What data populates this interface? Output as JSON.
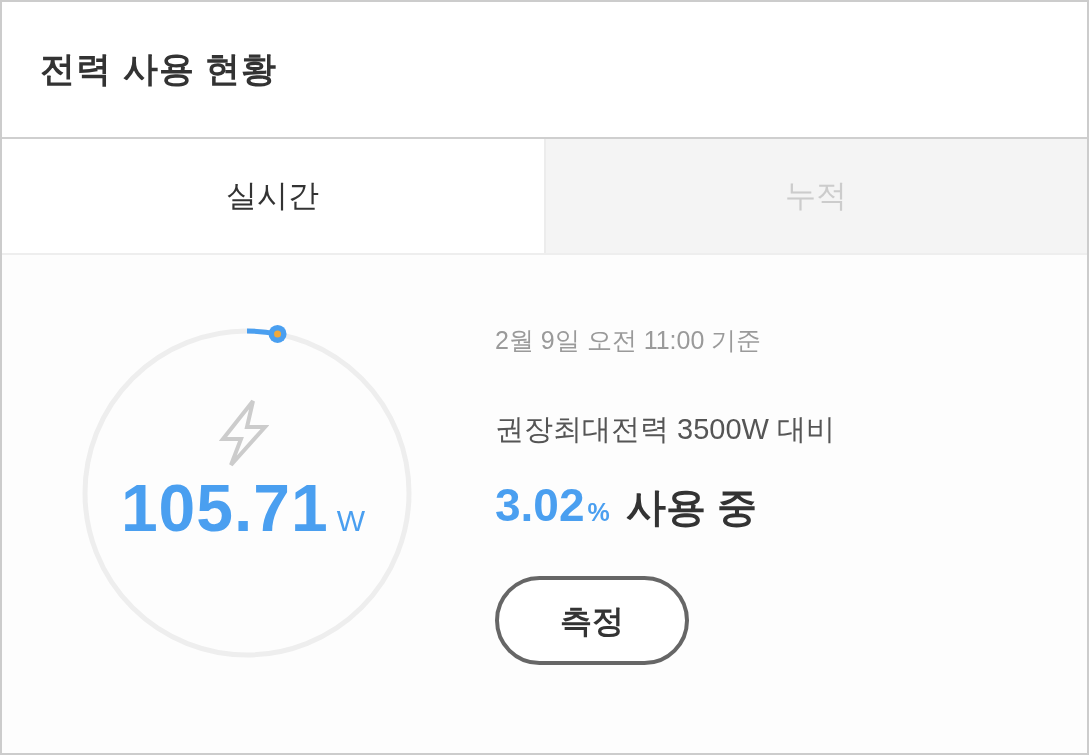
{
  "header": {
    "title": "전력 사용 현황"
  },
  "tabs": [
    {
      "label": "실시간",
      "selected": true
    },
    {
      "label": "누적",
      "selected": false
    }
  ],
  "gauge": {
    "level": 0.0302,
    "value": "105.71",
    "unit": "W"
  },
  "info": {
    "timestamp": "2월 9일 오전 11:00 기준",
    "reference": "권장최대전력 3500W 대비",
    "percent": "3.02",
    "percent_unit": "%",
    "status": "사용 중"
  },
  "button": {
    "label": "측정"
  }
}
